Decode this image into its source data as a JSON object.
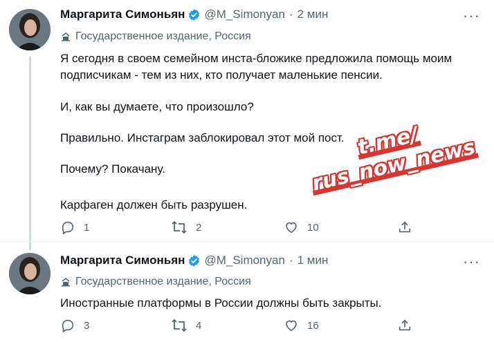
{
  "colors": {
    "accent": "#1d9bf0",
    "text": "#0f1419",
    "muted": "#536471",
    "watermark": "#d6362f"
  },
  "tweets": [
    {
      "author": "Маргарита Симоньян",
      "handle": "@M_Simonyan",
      "separator": "·",
      "time": "2 мин",
      "more": "···",
      "affiliation": "Государственное издание, Россия",
      "paragraphs": [
        "Я сегодня в своем семейном инста-бложике предложила помощь моим",
        "подписчикам - тем из них, кто получает маленькие пенсии.",
        "И, как вы думаете, что произошло?",
        "Правильно. Инстаграм заблокировал этот мой пост.",
        "Почему? Покачану.",
        "Карфаген должен быть разрушен."
      ],
      "replies": "1",
      "retweets": "2",
      "likes": "10"
    },
    {
      "author": "Маргарита Симоньян",
      "handle": "@M_Simonyan",
      "separator": "·",
      "time": "1 мин",
      "more": "···",
      "affiliation": "Государственное издание, Россия",
      "paragraphs": [
        "Иностранные платформы в России должны быть закрыты."
      ],
      "replies": "3",
      "retweets": "4",
      "likes": "16"
    }
  ],
  "watermark": {
    "line1": "t.me/",
    "line2": "rus_now_news"
  }
}
